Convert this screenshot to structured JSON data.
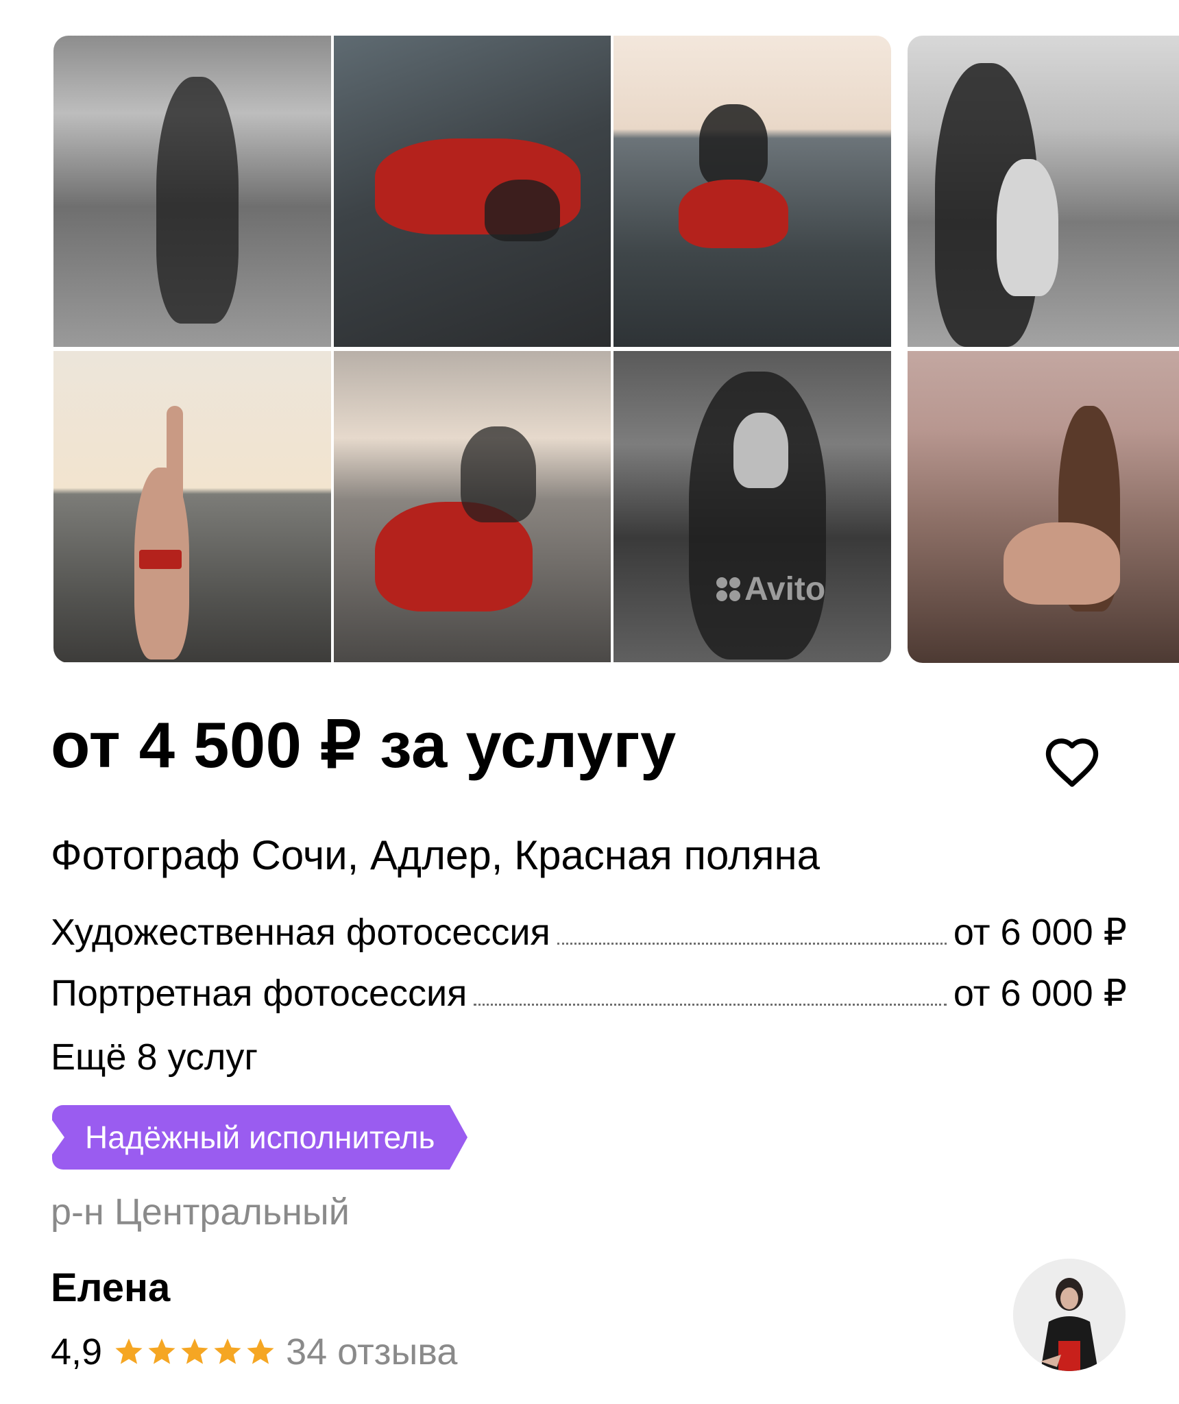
{
  "listing": {
    "price": "от 4 500 ₽ за услугу",
    "title": "Фотограф Сочи, Адлер, Красная поляна",
    "services": [
      {
        "name": "Художественная фотосессия",
        "price": "от 6 000 ₽"
      },
      {
        "name": "Портретная фотосессия",
        "price": "от 6 000 ₽"
      }
    ],
    "more_services": "Ещё 8 услуг",
    "badge": "Надёжный исполнитель",
    "district": "р-н Центральный"
  },
  "gallery": {
    "watermark": "Avito"
  },
  "seller": {
    "name": "Елена",
    "rating": "4,9",
    "stars": 5,
    "reviews": "34 отзыва"
  },
  "colors": {
    "badge": "#9a5cf0",
    "star": "#f5a623",
    "muted_text": "#8a8a8a",
    "text": "#000000"
  },
  "icons": {
    "favorite": "heart-outline-icon",
    "star": "star-icon"
  }
}
